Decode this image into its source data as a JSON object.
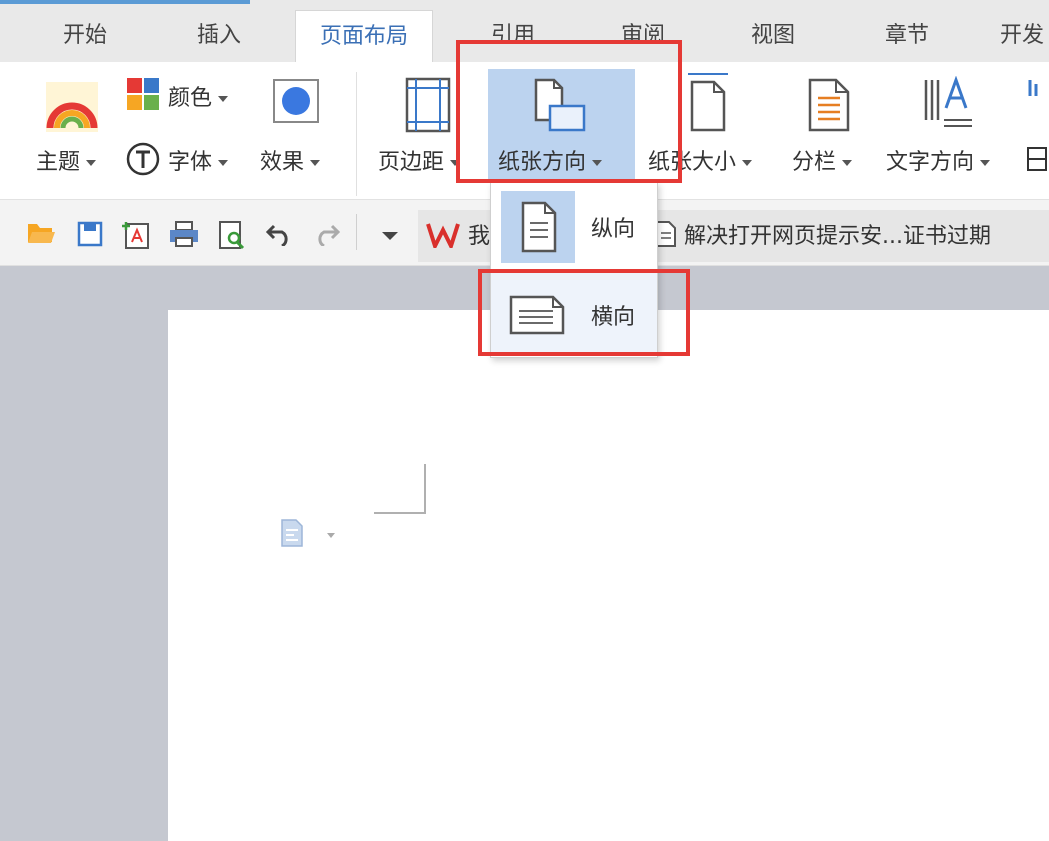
{
  "tabs": [
    {
      "label": "开始",
      "active": false
    },
    {
      "label": "插入",
      "active": false
    },
    {
      "label": "页面布局",
      "active": true
    },
    {
      "label": "引用",
      "active": false
    },
    {
      "label": "审阅",
      "active": false
    },
    {
      "label": "视图",
      "active": false
    },
    {
      "label": "章节",
      "active": false
    },
    {
      "label": "开发",
      "active": false
    }
  ],
  "ribbon": {
    "color": "颜色",
    "theme": "主题",
    "font": "字体",
    "effect": "效果",
    "margins": "页边距",
    "orientation": "纸张方向",
    "paper_size": "纸张大小",
    "columns": "分栏",
    "text_direction": "文字方向"
  },
  "quick_access": {
    "doc_tab_title": "解决打开网页提示安...证书过期",
    "wps_tab_char": "我"
  },
  "orientation_menu": {
    "portrait": "纵向",
    "landscape": "横向"
  },
  "colors": {
    "highlight_red": "#e53935",
    "selected_blue": "#bcd3ef",
    "wps_red": "#d9302c",
    "accent_blue": "#3a6fb5"
  }
}
